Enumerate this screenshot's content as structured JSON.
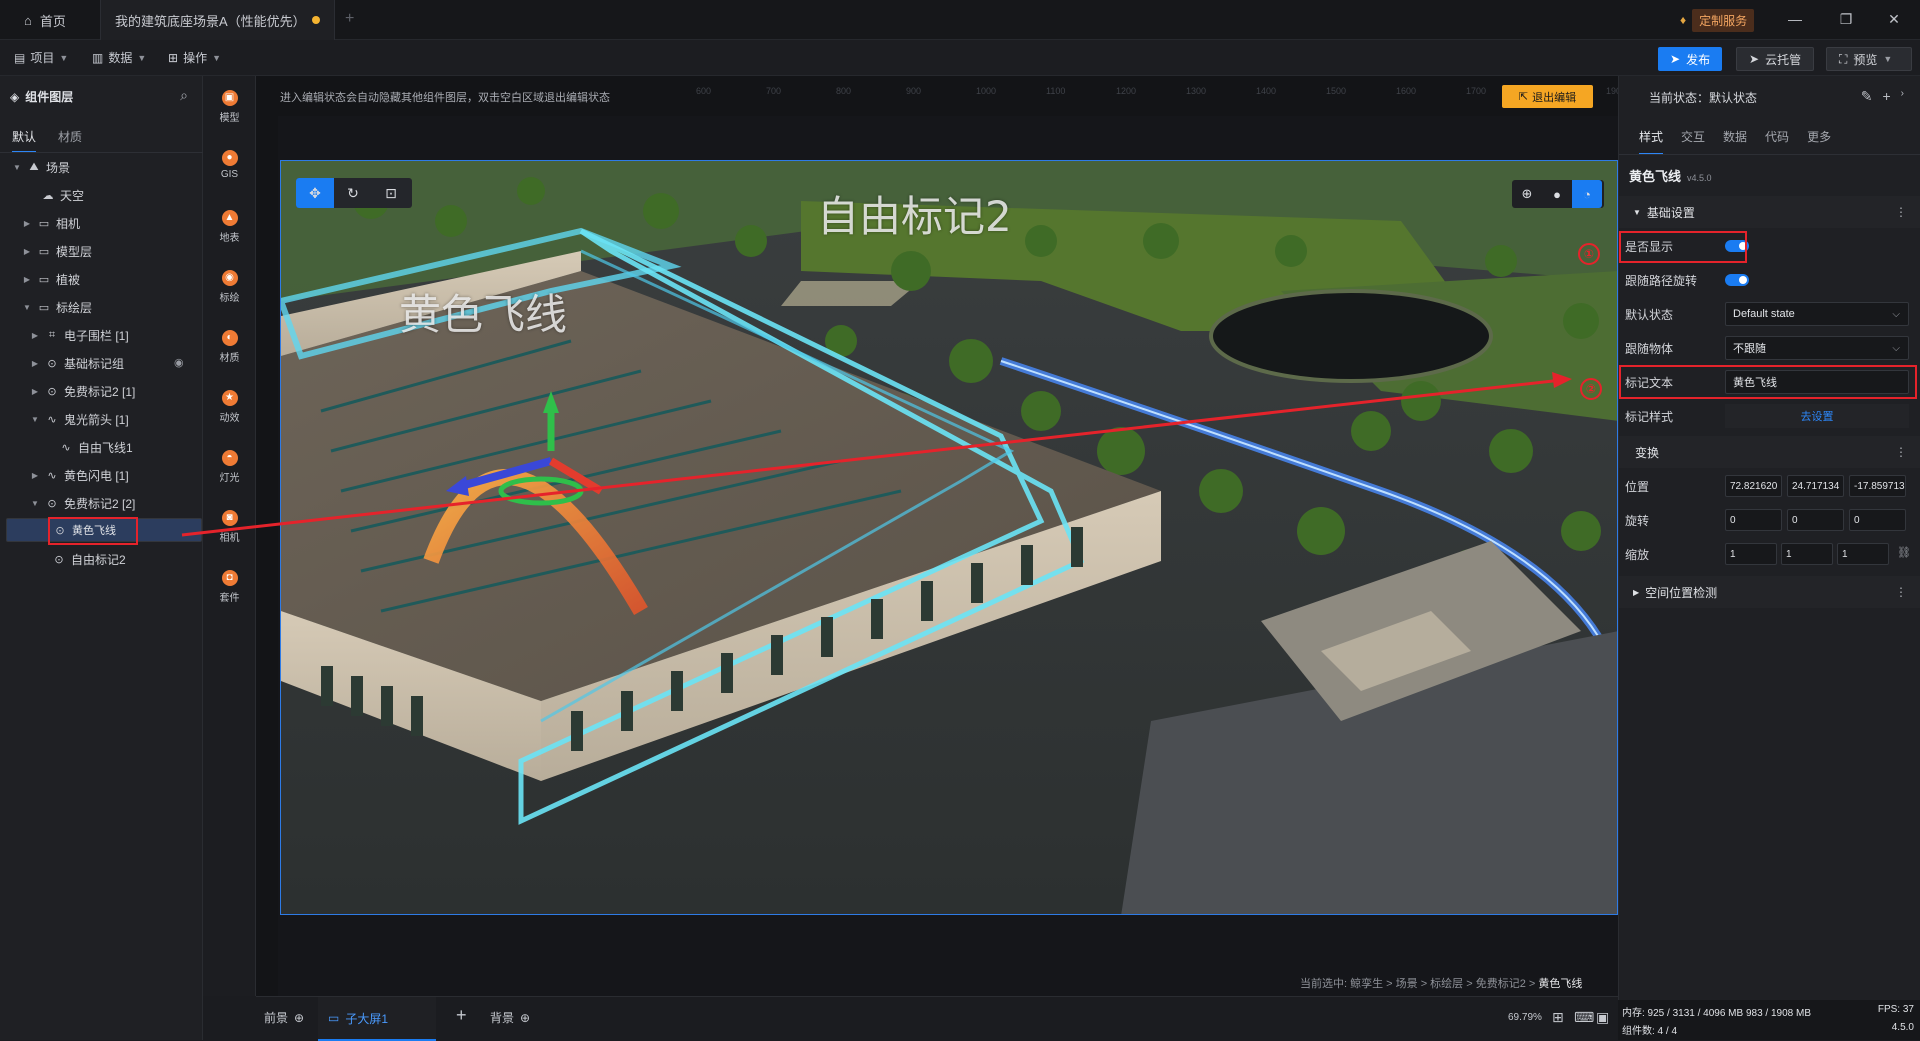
{
  "titlebar": {
    "home_label": "首页",
    "scene_tab": "我的建筑底座场景A（性能优先）",
    "new_tab": "+",
    "custom_service": "定制服务",
    "min": "—",
    "restore": "❐",
    "close": "✕"
  },
  "menubar": {
    "project": "项目",
    "data": "数据",
    "operate": "操作",
    "publish": "发布",
    "cloud": "云托管",
    "preview": "预览"
  },
  "layers": {
    "title": "组件图层",
    "tabs": [
      "默认",
      "材质"
    ],
    "items": [
      {
        "label": "场景"
      },
      {
        "label": "天空"
      },
      {
        "label": "相机"
      },
      {
        "label": "模型层"
      },
      {
        "label": "植被"
      },
      {
        "label": "标绘层"
      },
      {
        "label": "电子围栏 [1]"
      },
      {
        "label": "基础标记组"
      },
      {
        "label": "免费标记2 [1]"
      },
      {
        "label": "鬼光箭头 [1]"
      },
      {
        "label": "自由飞线1"
      },
      {
        "label": "黄色闪电 [1]"
      },
      {
        "label": "免费标记2 [2]"
      },
      {
        "label": "黄色飞线"
      },
      {
        "label": "自由标记2"
      }
    ]
  },
  "tools": [
    "模型",
    "GIS",
    "地表",
    "标绘",
    "材质",
    "动效",
    "灯光",
    "相机",
    "套件"
  ],
  "canvas": {
    "hint": "进入编辑状态会自动隐藏其他组件图层，双击空白区域退出编辑状态",
    "exit": "退出编辑",
    "label_a": "自由标记2",
    "label_b": "黄色飞线",
    "ruler_ticks": [
      "600",
      "700",
      "800",
      "900",
      "1000",
      "1100",
      "1200",
      "1300",
      "1400",
      "1500",
      "1600",
      "1700",
      "1800",
      "1900"
    ],
    "breadcrumb_prefix": "当前选中: 鲸孪生 > 场景 > 标绘层 > 免费标记2 > ",
    "breadcrumb_current": "黄色飞线"
  },
  "bottom": {
    "front": "前景",
    "sub": "子大屏1",
    "add": "+",
    "back": "背景",
    "zoom": "69.79%"
  },
  "props": {
    "state": "当前状态：默认状态",
    "tabs": [
      "样式",
      "交互",
      "数据",
      "代码",
      "更多"
    ],
    "title": "黄色飞线",
    "version": "v4.5.0",
    "basic": "基础设置",
    "show": "是否显示",
    "follow_rotate": "跟随路径旋转",
    "default_state": "默认状态",
    "default_state_val": "Default state",
    "follow_obj": "跟随物体",
    "follow_obj_val": "不跟随",
    "mark_text": "标记文本",
    "mark_text_val": "黄色飞线",
    "mark_style": "标记样式",
    "mark_style_link": "去设置",
    "transform": "变换",
    "position": "位置",
    "pos_x": "72.821620",
    "pos_y": "24.717134",
    "pos_z": "-17.859713",
    "rotation": "旋转",
    "rot_x": "0",
    "rot_y": "0",
    "rot_z": "0",
    "scale": "缩放",
    "sc_x": "1",
    "sc_y": "1",
    "sc_z": "1",
    "spatial": "空间位置检测",
    "circle1": "①",
    "circle2": "②"
  },
  "status": {
    "mem": "内存: 925 / 3131 / 4096 MB  983 / 1908 MB",
    "fps": "FPS:  37",
    "comp": "组件数: 4 / 4",
    "ver": "4.5.0"
  }
}
